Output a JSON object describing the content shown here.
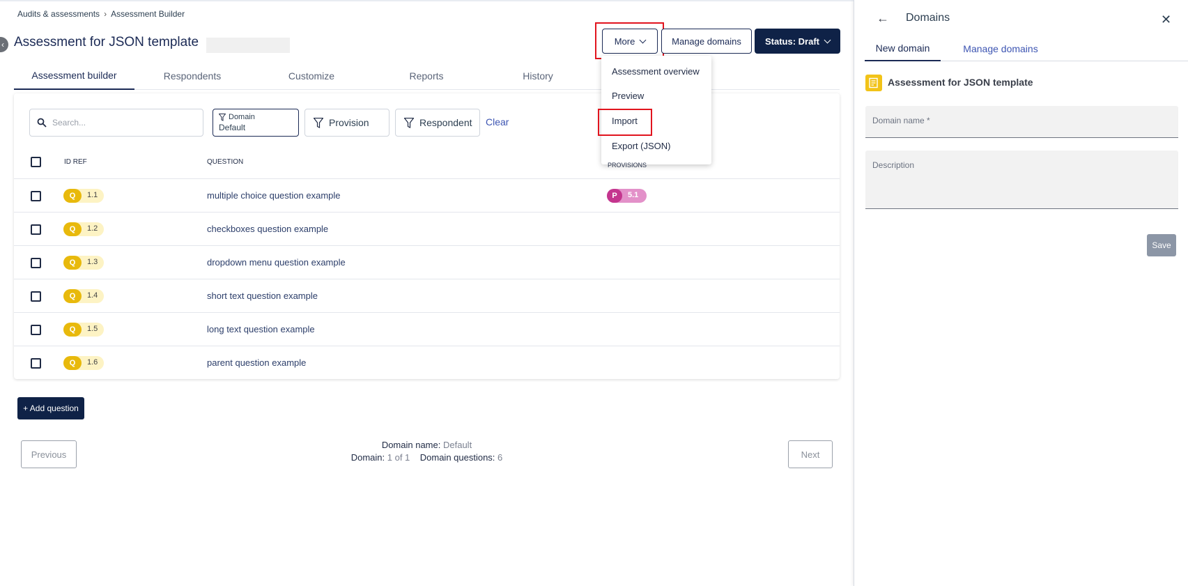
{
  "breadcrumb": {
    "parent": "Audits & assessments",
    "current": "Assessment Builder"
  },
  "page": {
    "title": "Assessment for JSON template"
  },
  "toolbar": {
    "more_label": "More",
    "manage_label": "Manage domains",
    "status_label": "Status: Draft"
  },
  "tabs": [
    "Assessment builder",
    "Respondents",
    "Customize",
    "Reports",
    "History"
  ],
  "filters": {
    "search_placeholder": "Search...",
    "domain_label": "Domain",
    "domain_value": "Default",
    "provision_label": "Provision",
    "respondent_label": "Respondent",
    "clear_label": "Clear"
  },
  "table": {
    "headers": {
      "id_ref": "ID REF",
      "question": "QUESTION",
      "provisions": "PROVISIONS"
    },
    "rows": [
      {
        "badge": "Q",
        "id": "1.1",
        "question": "multiple choice question example",
        "provision_badge": "P",
        "provision_id": "5.1"
      },
      {
        "badge": "Q",
        "id": "1.2",
        "question": "checkboxes question example"
      },
      {
        "badge": "Q",
        "id": "1.3",
        "question": "dropdown menu question example"
      },
      {
        "badge": "Q",
        "id": "1.4",
        "question": "short text question example"
      },
      {
        "badge": "Q",
        "id": "1.5",
        "question": "long text question example"
      },
      {
        "badge": "Q",
        "id": "1.6",
        "question": "parent question example"
      }
    ]
  },
  "add_question_label": "+ Add question",
  "pager": {
    "previous": "Previous",
    "next": "Next",
    "domain_name_label": "Domain name:",
    "domain_name_value": "Default",
    "domain_label": "Domain:",
    "domain_value": "1 of 1",
    "questions_label": "Domain questions:",
    "questions_value": "6"
  },
  "more_menu": [
    "Assessment overview",
    "Preview",
    "Import",
    "Export (JSON)"
  ],
  "panel": {
    "title": "Domains",
    "tabs": [
      "New domain",
      "Manage domains"
    ],
    "assessment_name": "Assessment for JSON template",
    "domain_name_label": "Domain name *",
    "description_label": "Description",
    "save_label": "Save"
  },
  "colors": {
    "primary": "#0f2247",
    "question_badge": "#e8b90c",
    "provision_badge": "#c4358e",
    "highlight": "#e1141e",
    "link": "#3d55b2"
  }
}
